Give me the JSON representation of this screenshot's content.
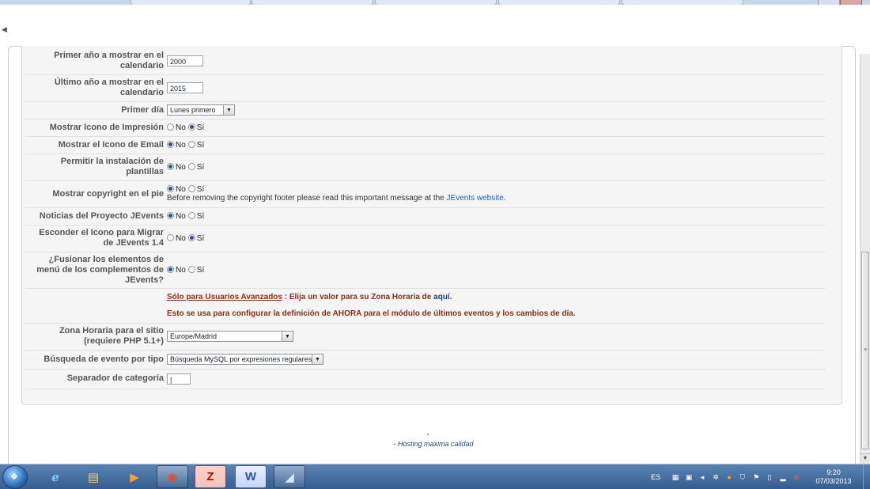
{
  "rows": [
    {
      "label": "Primer año a mostrar en el calendario",
      "type": "text",
      "value": "2000"
    },
    {
      "label": "Último año a mostrar en el calendario",
      "type": "text",
      "value": "2015"
    },
    {
      "label": "Primer día",
      "type": "select",
      "value": "Lunes primero"
    },
    {
      "label": "Mostrar Icono de Impresión",
      "type": "radio",
      "selected": "Sí"
    },
    {
      "label": "Mostrar el Icono de Email",
      "type": "radio",
      "selected": "No"
    },
    {
      "label": "Permitir la instalación de plantillas",
      "type": "radio",
      "selected": "No"
    },
    {
      "label": "Mostrar copyright en el pie",
      "type": "radio",
      "selected": "No",
      "note_text": "Before removing the copyright footer please read this important message at the ",
      "note_link": "JEvents website",
      "note_end": "."
    },
    {
      "label": "Noticias del Proyecto JEvents",
      "type": "radio",
      "selected": "No"
    },
    {
      "label": "Esconder el Icono para Migrar de JEvents 1.4",
      "type": "radio",
      "selected": "Sí"
    },
    {
      "label": "¿Fusionar los elementos de menú de los complementos de JEvents?",
      "type": "radio",
      "selected": "No"
    }
  ],
  "radio_options": {
    "no": "No",
    "si": "Sí"
  },
  "advanced": {
    "heading": "Sólo para Usuarios Avanzados",
    "text1": " : Elija un valor para su Zona Horaria de ",
    "link": "aquí",
    "text1_end": ".",
    "text2": "Esto se usa para configurar la definición de AHORA para el módulo de últimos eventos y los cambios de día."
  },
  "timezone": {
    "label": "Zona Horaria para el sitio (requiere PHP 5.1+)",
    "value": "Europe/Madrid"
  },
  "search_type": {
    "label": "Búsqueda de evento por tipo",
    "value": "Búsqueda MySQL por expresiones regulares"
  },
  "separator": {
    "label": "Separador de categoría",
    "value": "|"
  },
  "footer": {
    "link": "- Hosting maxima calidad"
  },
  "taskbar": {
    "apps": [
      "internet-explorer-icon",
      "file-explorer-icon",
      "media-player-icon",
      "chrome-icon",
      "filezilla-icon",
      "word-icon",
      "document-icon"
    ],
    "lang": "ES",
    "time": "9:20",
    "date": "07/03/2013"
  },
  "colors": {
    "advanced": "#8b2d15",
    "link": "#1f5fa8",
    "taskbar": "#355d8e"
  }
}
